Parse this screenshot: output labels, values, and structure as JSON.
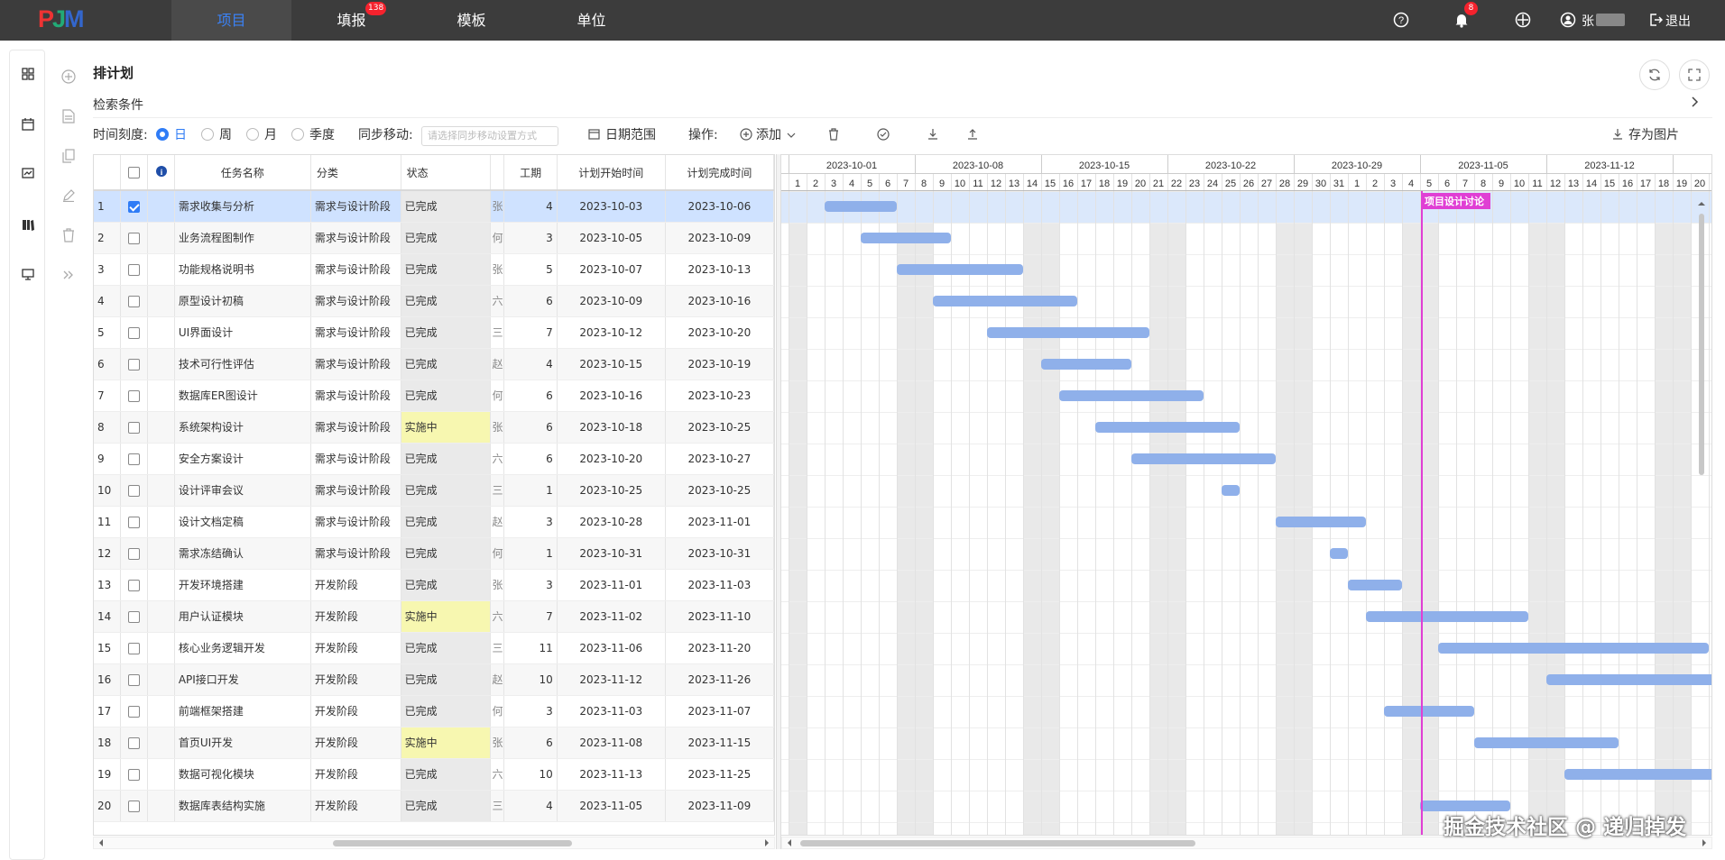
{
  "app": {
    "logo": "PJM",
    "page_title": "排计划",
    "search_label": "检索条件"
  },
  "nav": [
    {
      "label": "项目",
      "active": true
    },
    {
      "label": "填报",
      "badge": "138"
    },
    {
      "label": "模板"
    },
    {
      "label": "单位"
    }
  ],
  "top": {
    "notify_badge": "8",
    "user_name": "张",
    "logout": "退出"
  },
  "toolbar": {
    "scale_label": "时间刻度:",
    "scale_options": [
      "日",
      "周",
      "月",
      "季度"
    ],
    "sync_label": "同步移动:",
    "sync_placeholder": "请选择同步移动设置方式",
    "date_range": "日期范围",
    "ops_label": "操作:",
    "add": "添加",
    "save_image": "存为图片"
  },
  "table": {
    "columns": [
      "任务名称",
      "分类",
      "状态",
      "工期",
      "计划开始时间",
      "计划完成时间"
    ],
    "rows": [
      {
        "no": "1",
        "checked": true,
        "name": "需求收集与分析",
        "category": "需求与设计阶段",
        "status": "已完成",
        "owner": "张",
        "duration": "4",
        "start": "2023-10-03",
        "end": "2023-10-06"
      },
      {
        "no": "2",
        "name": "业务流程图制作",
        "category": "需求与设计阶段",
        "status": "已完成",
        "owner": "何",
        "duration": "3",
        "start": "2023-10-05",
        "end": "2023-10-09"
      },
      {
        "no": "3",
        "name": "功能规格说明书",
        "category": "需求与设计阶段",
        "status": "已完成",
        "owner": "张",
        "duration": "5",
        "start": "2023-10-07",
        "end": "2023-10-13"
      },
      {
        "no": "4",
        "name": "原型设计初稿",
        "category": "需求与设计阶段",
        "status": "已完成",
        "owner": "六",
        "duration": "6",
        "start": "2023-10-09",
        "end": "2023-10-16"
      },
      {
        "no": "5",
        "name": "UI界面设计",
        "category": "需求与设计阶段",
        "status": "已完成",
        "owner": "三",
        "duration": "7",
        "start": "2023-10-12",
        "end": "2023-10-20"
      },
      {
        "no": "6",
        "name": "技术可行性评估",
        "category": "需求与设计阶段",
        "status": "已完成",
        "owner": "赵",
        "duration": "4",
        "start": "2023-10-15",
        "end": "2023-10-19"
      },
      {
        "no": "7",
        "name": "数据库ER图设计",
        "category": "需求与设计阶段",
        "status": "已完成",
        "owner": "何",
        "duration": "6",
        "start": "2023-10-16",
        "end": "2023-10-23"
      },
      {
        "no": "8",
        "name": "系统架构设计",
        "category": "需求与设计阶段",
        "status": "实施中",
        "owner": "张",
        "duration": "6",
        "start": "2023-10-18",
        "end": "2023-10-25"
      },
      {
        "no": "9",
        "name": "安全方案设计",
        "category": "需求与设计阶段",
        "status": "已完成",
        "owner": "六",
        "duration": "6",
        "start": "2023-10-20",
        "end": "2023-10-27"
      },
      {
        "no": "10",
        "name": "设计评审会议",
        "category": "需求与设计阶段",
        "status": "已完成",
        "owner": "三",
        "duration": "1",
        "start": "2023-10-25",
        "end": "2023-10-25"
      },
      {
        "no": "11",
        "name": "设计文档定稿",
        "category": "需求与设计阶段",
        "status": "已完成",
        "owner": "赵",
        "duration": "3",
        "start": "2023-10-28",
        "end": "2023-11-01"
      },
      {
        "no": "12",
        "name": "需求冻结确认",
        "category": "需求与设计阶段",
        "status": "已完成",
        "owner": "何",
        "duration": "1",
        "start": "2023-10-31",
        "end": "2023-10-31"
      },
      {
        "no": "13",
        "name": "开发环境搭建",
        "category": "开发阶段",
        "status": "已完成",
        "owner": "张",
        "duration": "3",
        "start": "2023-11-01",
        "end": "2023-11-03"
      },
      {
        "no": "14",
        "name": "用户认证模块",
        "category": "开发阶段",
        "status": "实施中",
        "owner": "六",
        "duration": "7",
        "start": "2023-11-02",
        "end": "2023-11-10"
      },
      {
        "no": "15",
        "name": "核心业务逻辑开发",
        "category": "开发阶段",
        "status": "已完成",
        "owner": "三",
        "duration": "11",
        "start": "2023-11-06",
        "end": "2023-11-20"
      },
      {
        "no": "16",
        "name": "API接口开发",
        "category": "开发阶段",
        "status": "已完成",
        "owner": "赵",
        "duration": "10",
        "start": "2023-11-12",
        "end": "2023-11-26"
      },
      {
        "no": "17",
        "name": "前端框架搭建",
        "category": "开发阶段",
        "status": "已完成",
        "owner": "何",
        "duration": "3",
        "start": "2023-11-03",
        "end": "2023-11-07"
      },
      {
        "no": "18",
        "name": "首页UI开发",
        "category": "开发阶段",
        "status": "实施中",
        "owner": "张",
        "duration": "6",
        "start": "2023-11-08",
        "end": "2023-11-15"
      },
      {
        "no": "19",
        "name": "数据可视化模块",
        "category": "开发阶段",
        "status": "已完成",
        "owner": "六",
        "duration": "10",
        "start": "2023-11-13",
        "end": "2023-11-25"
      },
      {
        "no": "20",
        "name": "数据库表结构实施",
        "category": "开发阶段",
        "status": "已完成",
        "owner": "三",
        "duration": "4",
        "start": "2023-11-05",
        "end": "2023-11-09"
      }
    ]
  },
  "gantt": {
    "week_labels": [
      "2023-10-01",
      "2023-10-08",
      "2023-10-15",
      "2023-10-22",
      "2023-10-29",
      "2023-11-05",
      "2023-11-12",
      "20"
    ],
    "start_day": "2023-10-01",
    "milestone": {
      "label": "项目设计讨论",
      "date": "2023-11-05"
    },
    "bar_color": "#8fb0ea",
    "milestone_color": "#e03fd4"
  },
  "watermark": "掘金技术社区 @ 递归掉发"
}
